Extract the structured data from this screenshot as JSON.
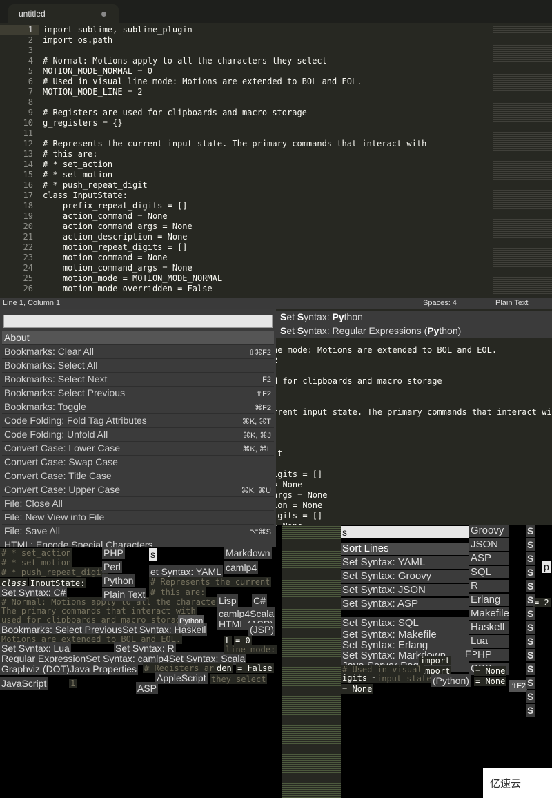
{
  "tab": {
    "title": "untitled"
  },
  "gutter": [
    "1",
    "2",
    "3",
    "4",
    "5",
    "6",
    "7",
    "8",
    "9",
    "10",
    "11",
    "12",
    "13",
    "14",
    "15",
    "16",
    "17",
    "18",
    "19",
    "20",
    "21",
    "22",
    "23",
    "24",
    "25",
    "26"
  ],
  "code": [
    "import sublime, sublime_plugin",
    "import os.path",
    "",
    "# Normal: Motions apply to all the characters they select",
    "MOTION_MODE_NORMAL = 0",
    "# Used in visual line mode: Motions are extended to BOL and EOL.",
    "MOTION_MODE_LINE = 2",
    "",
    "# Registers are used for clipboards and macro storage",
    "g_registers = {}",
    "",
    "# Represents the current input state. The primary commands that interact with",
    "# this are:",
    "# * set_action",
    "# * set_motion",
    "# * push_repeat_digit",
    "class InputState:",
    "    prefix_repeat_digits = []",
    "    action_command = None",
    "    action_command_args = None",
    "    action_description = None",
    "    motion_repeat_digits = []",
    "    motion_command = None",
    "    motion_command_args = None",
    "    motion_mode = MOTION_MODE_NORMAL",
    "    motion_mode_overridden = False"
  ],
  "status": {
    "position": "Line 1, Column 1",
    "spaces": "Spaces: 4",
    "syntax": "Plain Text"
  },
  "palette": {
    "items": [
      {
        "label": "About",
        "key": ""
      },
      {
        "label": "Bookmarks: Clear All",
        "key": "⇧⌘F2"
      },
      {
        "label": "Bookmarks: Select All",
        "key": ""
      },
      {
        "label": "Bookmarks: Select Next",
        "key": "F2"
      },
      {
        "label": "Bookmarks: Select Previous",
        "key": "⇧F2"
      },
      {
        "label": "Bookmarks: Toggle",
        "key": "⌘F2"
      },
      {
        "label": "Code Folding: Fold Tag Attributes",
        "key": "⌘K, ⌘T"
      },
      {
        "label": "Code Folding: Unfold All",
        "key": "⌘K, ⌘J"
      },
      {
        "label": "Convert Case: Lower Case",
        "key": "⌘K, ⌘L"
      },
      {
        "label": "Convert Case: Swap Case",
        "key": ""
      },
      {
        "label": "Convert Case: Title Case",
        "key": ""
      },
      {
        "label": "Convert Case: Upper Case",
        "key": "⌘K, ⌘U"
      },
      {
        "label": "File: Close All",
        "key": ""
      },
      {
        "label": "File: New View into File",
        "key": ""
      },
      {
        "label": "File: Save All",
        "key": "⌥⌘S"
      },
      {
        "label": "HTML: Encode Special Characters",
        "key": ""
      }
    ]
  },
  "syntax_results": [
    "Set Syntax: Python",
    "Set Syntax: Regular Expressions (Python)"
  ],
  "right_code": [
    "ne mode: Motions are extended to BOL and EOL.",
    "2",
    "d for clipboards and macro storage",
    "rrent input state. The primary commands that interact with",
    "it",
    "igits = []",
    "= None",
    "args = None",
    "ion = None",
    "igits = []",
    "= None"
  ],
  "collage": {
    "left": [
      "# * set_action",
      "# * set_motion",
      "# * push_repeat_digit",
      "class",
      "InputState:",
      "Set Syntax: C#",
      "# Normal: Motions apply to all the characters",
      "The primary commands that interact with",
      "used for clipboards and macro storage",
      "Bookmarks: Select PreviousSet Syntax: Haskell",
      "Motions are extended to BOL and EOL.",
      "Set Syntax: Lua",
      "Set Syntax: R",
      "Regular ExpressionSet Syntax: camlp4Set Syntax: Scala",
      "Graphviz (DOT)Java Properties",
      "JavaScript",
      "1",
      "ASP",
      "PHP",
      "Perl",
      "Python",
      "Plain Text",
      "s",
      "Markdown",
      "camlp4",
      "et Syntax: YAML",
      "# Represents the current",
      "# this are:",
      "Lisp",
      "C#",
      "camlp4Scala",
      "Python",
      "HTML (ASP)",
      "(JSP)",
      "L",
      "= 0",
      "line mode:",
      "# Registers are",
      "den",
      "= False",
      "AppleScript",
      "they select"
    ],
    "right_input": "s",
    "right_list": [
      "Sort Lines",
      "Set Syntax: YAML",
      "Set Syntax: Groovy",
      "Set Syntax: JSON",
      "Set Syntax: ASP",
      "Set Syntax: SQL",
      "Set Syntax: Makefile",
      "Set Syntax: Erlang",
      "Set Syntax: Markdown",
      "Java Server Page"
    ],
    "right_col": [
      "Groovy",
      "JSON",
      "ASP",
      "SQL",
      "R",
      "Erlang",
      "Makefile",
      "Haskell",
      "Lua",
      "PHP",
      "CSS"
    ],
    "misc": [
      "import",
      "import",
      "# Used in visual",
      "igits =",
      "= None",
      "input state.",
      "(Python)",
      "= None",
      "= None",
      "⇧F2",
      "p",
      "= 2",
      "F"
    ],
    "s_letter": "S"
  },
  "watermark": "亿速云",
  "colors": {
    "editor_bg": "#272822",
    "palette_bg": "#3b3b3b",
    "keyword": "#f92672",
    "number": "#ae81ff",
    "comment": "#75715e"
  }
}
